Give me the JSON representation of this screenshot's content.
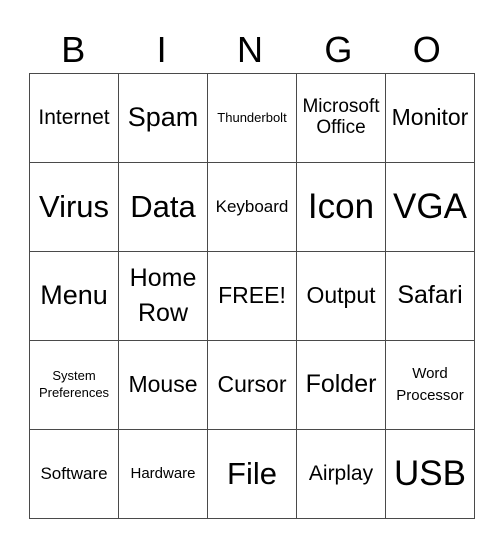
{
  "header": [
    "B",
    "I",
    "N",
    "G",
    "O"
  ],
  "rows": [
    [
      "Internet",
      "Spam",
      "Thunderbolt",
      "Microsoft Office",
      "Monitor"
    ],
    [
      "Virus",
      "Data",
      "Keyboard",
      "Icon",
      "VGA"
    ],
    [
      "Menu",
      "Home Row",
      "FREE!",
      "Output",
      "Safari"
    ],
    [
      "System Preferences",
      "Mouse",
      "Cursor",
      "Folder",
      "Word Processor"
    ],
    [
      "Software",
      "Hardware",
      "File",
      "Airplay",
      "USB"
    ]
  ]
}
